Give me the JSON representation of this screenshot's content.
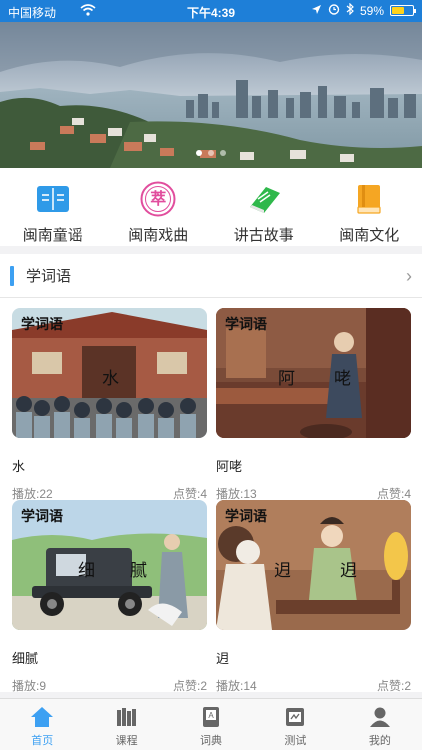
{
  "status": {
    "carrier": "中国移动",
    "time": "下午4:39",
    "battery": "59%",
    "battery_level": 0.59
  },
  "colors": {
    "accent": "#3da0f2",
    "status_bar": "#1e7fd8"
  },
  "banner": {
    "slides": 3,
    "active": 0
  },
  "quick_nav": [
    {
      "label": "闽南童谣",
      "icon": "book-icon"
    },
    {
      "label": "闽南戏曲",
      "icon": "opera-badge-icon",
      "badge": "萃"
    },
    {
      "label": "讲古故事",
      "icon": "green-book-icon"
    },
    {
      "label": "闽南文化",
      "icon": "orange-book-icon"
    }
  ],
  "section": {
    "title": "学词语",
    "more": "›"
  },
  "cards": [
    {
      "tag": "学词语",
      "words": [
        "水"
      ],
      "name": "水",
      "plays": "播放:22",
      "likes": "点赞:4"
    },
    {
      "tag": "学词语",
      "words": [
        "阿",
        "咾"
      ],
      "name": "阿咾",
      "plays": "播放:13",
      "likes": "点赞:4"
    },
    {
      "tag": "学词语",
      "words": [
        "细",
        "腻"
      ],
      "name": "细腻",
      "plays": "播放:9",
      "likes": "点赞:2"
    },
    {
      "tag": "学词语",
      "words": [
        "迌",
        "迌"
      ],
      "name": "迌",
      "plays": "播放:14",
      "likes": "点赞:2"
    }
  ],
  "tabs": [
    {
      "label": "首页",
      "icon": "home-icon",
      "active": true
    },
    {
      "label": "课程",
      "icon": "books-icon"
    },
    {
      "label": "词典",
      "icon": "dictionary-icon"
    },
    {
      "label": "测试",
      "icon": "test-icon"
    },
    {
      "label": "我的",
      "icon": "profile-icon"
    }
  ]
}
